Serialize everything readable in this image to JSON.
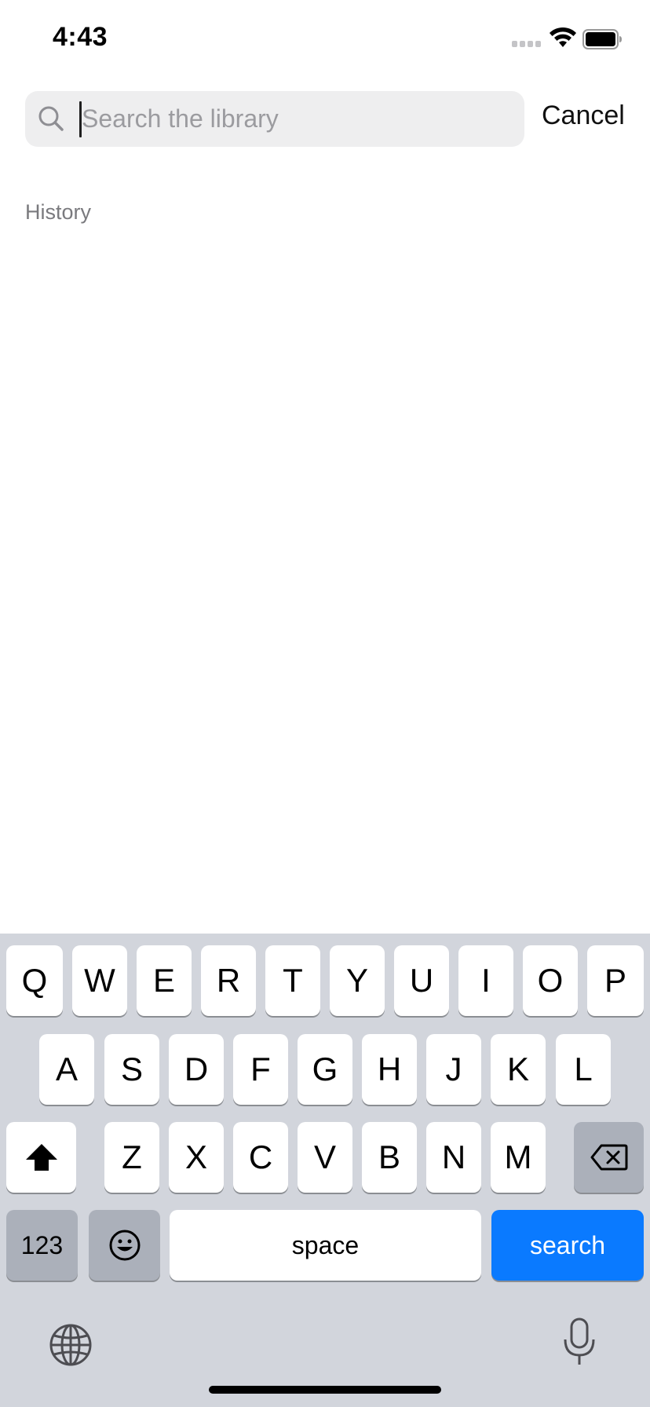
{
  "status_bar": {
    "time": "4:43",
    "icons": [
      "cellular-signal-icon",
      "wifi-icon",
      "battery-icon"
    ]
  },
  "search": {
    "placeholder": "Search the library",
    "value": "",
    "icon": "search-icon",
    "cancel_label": "Cancel"
  },
  "history": {
    "heading": "History",
    "items": []
  },
  "keyboard": {
    "row1": [
      "Q",
      "W",
      "E",
      "R",
      "T",
      "Y",
      "U",
      "I",
      "O",
      "P"
    ],
    "row2": [
      "A",
      "S",
      "D",
      "F",
      "G",
      "H",
      "J",
      "K",
      "L"
    ],
    "row3": [
      "Z",
      "X",
      "C",
      "V",
      "B",
      "N",
      "M"
    ],
    "numbers_label": "123",
    "space_label": "space",
    "search_label": "search",
    "icons": [
      "shift-icon",
      "backspace-icon",
      "emoji-icon",
      "globe-icon",
      "microphone-icon"
    ],
    "accent_color": "#0a7aff"
  }
}
